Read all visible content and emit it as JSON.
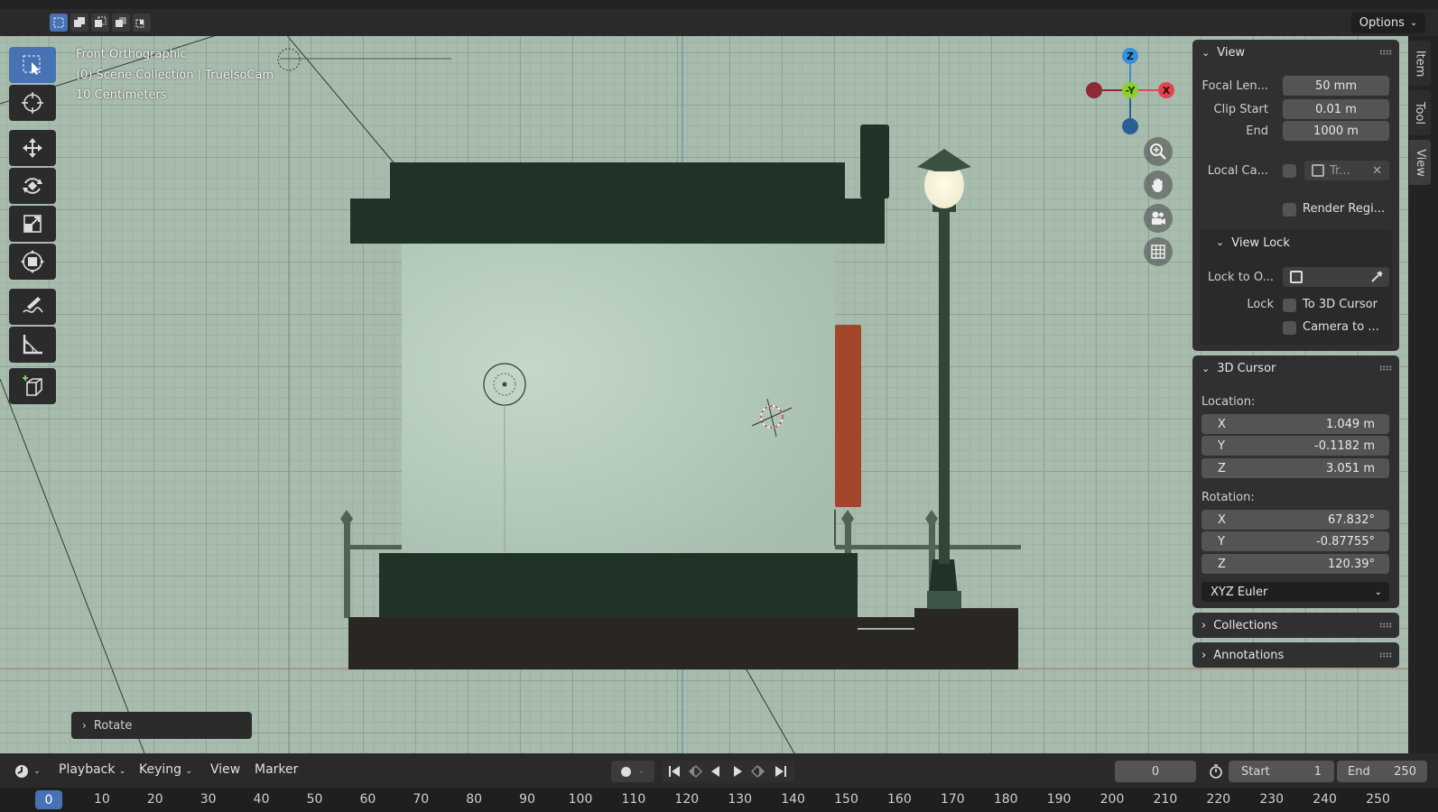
{
  "header": {
    "options_label": "Options"
  },
  "viewport": {
    "view_name": "Front Orthographic",
    "collection_info": "(0) Scene Collection | TrueIsoCam",
    "scale": "10 Centimeters",
    "last_operator": "Rotate",
    "gizmo_labels": {
      "z": "Z",
      "y": "Y",
      "x": "X"
    }
  },
  "tools": [
    "select-box",
    "cursor",
    "move",
    "rotate",
    "scale",
    "transform",
    "annotate",
    "measure",
    "add-cube"
  ],
  "sidebar": {
    "tabs": [
      "Item",
      "Tool",
      "View"
    ],
    "active_tab": "View",
    "view_panel": {
      "title": "View",
      "focal_length_label": "Focal Len...",
      "focal_length_value": "50 mm",
      "clip_start_label": "Clip Start",
      "clip_start_value": "0.01 m",
      "clip_end_label": "End",
      "clip_end_value": "1000 m",
      "local_camera_label": "Local Ca...",
      "local_camera_value": "Tr...",
      "render_region_label": "Render Regi...",
      "view_lock_title": "View Lock",
      "lock_to_object_label": "Lock to O...",
      "lock_label": "Lock",
      "lock_to_cursor_label": "To 3D Cursor",
      "camera_to_view_label": "Camera to ..."
    },
    "cursor_panel": {
      "title": "3D Cursor",
      "location_label": "Location:",
      "location": [
        {
          "axis": "X",
          "value": "1.049 m"
        },
        {
          "axis": "Y",
          "value": "-0.1182 m"
        },
        {
          "axis": "Z",
          "value": "3.051 m"
        }
      ],
      "rotation_label": "Rotation:",
      "rotation": [
        {
          "axis": "X",
          "value": "67.832°"
        },
        {
          "axis": "Y",
          "value": "-0.87755°"
        },
        {
          "axis": "Z",
          "value": "120.39°"
        }
      ],
      "rotation_mode": "XYZ Euler"
    },
    "collections_title": "Collections",
    "annotations_title": "Annotations"
  },
  "timeline": {
    "menus": [
      "Playback",
      "Keying",
      "View",
      "Marker"
    ],
    "current_frame": "0",
    "start_label": "Start",
    "start_value": "1",
    "end_label": "End",
    "end_value": "250",
    "ruler": [
      "0",
      "10",
      "20",
      "30",
      "40",
      "50",
      "60",
      "70",
      "80",
      "90",
      "100",
      "110",
      "120",
      "130",
      "140",
      "150",
      "160",
      "170",
      "180",
      "190",
      "200",
      "210",
      "220",
      "230",
      "240",
      "250"
    ]
  },
  "colors": {
    "accent": "#4772b3",
    "viewport_bg": "#a8bcae",
    "axis_x": "#e04452",
    "axis_y": "#8bd12e",
    "axis_z": "#3a8fd9",
    "roof": "#1f3328",
    "wall": "#b7cebf",
    "door": "#a3462b",
    "base": "#2a2622"
  }
}
